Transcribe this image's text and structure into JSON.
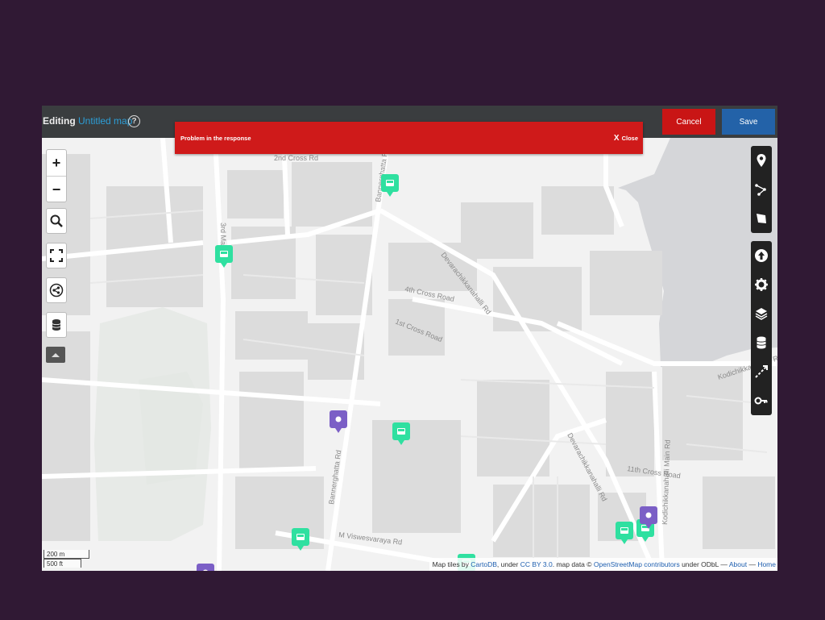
{
  "header": {
    "editing_label": "Editing",
    "map_name": "Untitled map",
    "help_symbol": "?",
    "cancel_label": "Cancel",
    "save_label": "Save"
  },
  "alert": {
    "message": "Problem in the response",
    "close_symbol": "X",
    "close_label": "Close"
  },
  "map_controls": {
    "zoom_in": "+",
    "zoom_out": "−",
    "left_icons": [
      "search-icon",
      "fullscreen-icon",
      "share-icon",
      "data-layers-icon",
      "toggle-up-icon"
    ],
    "right_tools_top": [
      "marker-icon",
      "polyline-icon",
      "polygon-icon"
    ],
    "right_tools_bottom": [
      "upload-icon",
      "settings-icon",
      "layers-icon",
      "datalayer-icon",
      "centre-zoom-icon",
      "permissions-icon"
    ]
  },
  "scale": {
    "metric": "200 m",
    "imperial": "500 ft"
  },
  "attribution": {
    "prefix": "Map tiles by",
    "cartodb": "CartoDB",
    "under": ", under",
    "ccby": "CC BY 3.0",
    "mapdata": ". map data ©",
    "osm": "OpenStreetMap contributors",
    "odbl": "under ODbL —",
    "about": "About",
    "dash": "—",
    "home": "Home"
  },
  "streets": [
    "Bannerghatta Rd",
    "Bannerghatta Rd",
    "Devarachikkanahalli Rd",
    "Devarachikkanahalli Rd",
    "M Viswesvaraya Rd",
    "Kodichikkanahalli Main Rd",
    "Kodichikkanahalli Rd",
    "3rd Main Rd",
    "2nd Cross Rd",
    "4th Cross Road",
    "1st Cross Road",
    "11th Cross Road"
  ],
  "markers": [
    {
      "type": "bus",
      "color": "#2fe0a0"
    },
    {
      "type": "bus",
      "color": "#2fe0a0"
    },
    {
      "type": "bus",
      "color": "#2fe0a0"
    },
    {
      "type": "pin",
      "color": "#7b5fc6"
    },
    {
      "type": "bus",
      "color": "#2fe0a0"
    },
    {
      "type": "bus",
      "color": "#2fe0a0"
    },
    {
      "type": "bus",
      "color": "#2fe0a0"
    },
    {
      "type": "bus",
      "color": "#2fe0a0"
    },
    {
      "type": "pin",
      "color": "#7b5fc6"
    },
    {
      "type": "pin",
      "color": "#7b5fc6"
    }
  ],
  "colors": {
    "accent": "#2c9fd8",
    "cancel": "#c91515",
    "save": "#2362a8",
    "alert": "#cf1a1a",
    "bus_marker": "#2fe0a0",
    "pin_marker": "#7b5fc6"
  }
}
